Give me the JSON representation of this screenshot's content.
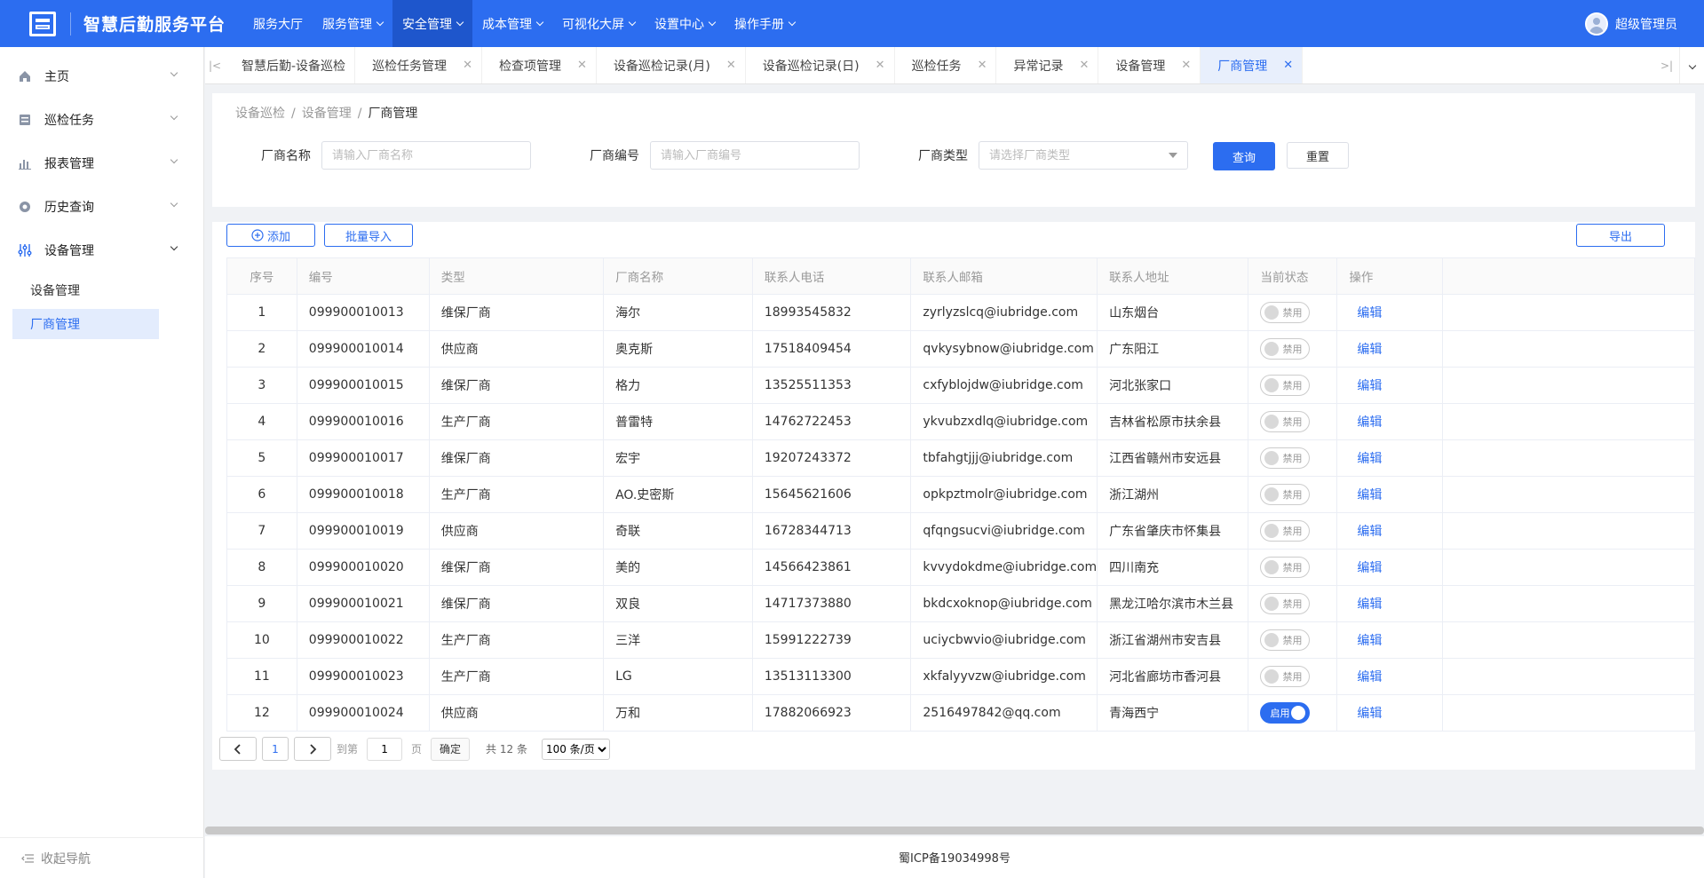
{
  "header": {
    "title": "智慧后勤服务平台",
    "nav": [
      "服务大厅",
      "服务管理",
      "安全管理",
      "成本管理",
      "可视化大屏",
      "设置中心",
      "操作手册"
    ],
    "user": "超级管理员"
  },
  "sidebar": {
    "items": [
      "主页",
      "巡检任务",
      "报表管理",
      "历史查询",
      "设备管理"
    ],
    "sub": [
      "设备管理",
      "厂商管理"
    ],
    "collapse": "收起导航"
  },
  "tabs": [
    "智慧后勤-设备巡检",
    "巡检任务管理",
    "检查项管理",
    "设备巡检记录(月)",
    "设备巡检记录(日)",
    "巡检任务",
    "异常记录",
    "设备管理",
    "厂商管理"
  ],
  "breadcrumb": [
    "设备巡检",
    "设备管理",
    "厂商管理"
  ],
  "filters": {
    "name_label": "厂商名称",
    "name_placeholder": "请输入厂商名称",
    "code_label": "厂商编号",
    "code_placeholder": "请输入厂商编号",
    "type_label": "厂商类型",
    "type_placeholder": "请选择厂商类型",
    "query": "查询",
    "reset": "重置"
  },
  "actions": {
    "add": "添加",
    "import": "批量导入",
    "export": "导出"
  },
  "table": {
    "headers": [
      "序号",
      "编号",
      "类型",
      "厂商名称",
      "联系人电话",
      "联系人邮箱",
      "联系人地址",
      "当前状态",
      "操作"
    ],
    "rows": [
      [
        "1",
        "099900010013",
        "维保厂商",
        "海尔",
        "18993545832",
        "zyrlyzslcq@iubridge.com",
        "山东烟台",
        "禁用",
        "编辑"
      ],
      [
        "2",
        "099900010014",
        "供应商",
        "奥克斯",
        "17518409454",
        "qvkysybnow@iubridge.com",
        "广东阳江",
        "禁用",
        "编辑"
      ],
      [
        "3",
        "099900010015",
        "维保厂商",
        "格力",
        "13525511353",
        "cxfyblojdw@iubridge.com",
        "河北张家口",
        "禁用",
        "编辑"
      ],
      [
        "4",
        "099900010016",
        "生产厂商",
        "普雷特",
        "14762722453",
        "ykvubzxdlq@iubridge.com",
        "吉林省松原市扶余县",
        "禁用",
        "编辑"
      ],
      [
        "5",
        "099900010017",
        "维保厂商",
        "宏宇",
        "19207243372",
        "tbfahgtjjj@iubridge.com",
        "江西省赣州市安远县",
        "禁用",
        "编辑"
      ],
      [
        "6",
        "099900010018",
        "生产厂商",
        "AO.史密斯",
        "15645621606",
        "opkpztmolr@iubridge.com",
        "浙江湖州",
        "禁用",
        "编辑"
      ],
      [
        "7",
        "099900010019",
        "供应商",
        "奇联",
        "16728344713",
        "qfqngsucvi@iubridge.com",
        "广东省肇庆市怀集县",
        "禁用",
        "编辑"
      ],
      [
        "8",
        "099900010020",
        "维保厂商",
        "美的",
        "14566423861",
        "kvvydokdme@iubridge.com",
        "四川南充",
        "禁用",
        "编辑"
      ],
      [
        "9",
        "099900010021",
        "维保厂商",
        "双良",
        "14717373880",
        "bkdcxoknop@iubridge.com",
        "黑龙江哈尔滨市木兰县",
        "禁用",
        "编辑"
      ],
      [
        "10",
        "099900010022",
        "生产厂商",
        "三洋",
        "15991222739",
        "uciycbwvio@iubridge.com",
        "浙江省湖州市安吉县",
        "禁用",
        "编辑"
      ],
      [
        "11",
        "099900010023",
        "生产厂商",
        "LG",
        "13513113300",
        "xkfalyyvzw@iubridge.com",
        "河北省廊坊市香河县",
        "禁用",
        "编辑"
      ],
      [
        "12",
        "099900010024",
        "供应商",
        "万和",
        "17882066923",
        "2516497842@qq.com",
        "青海西宁",
        "启用",
        "编辑"
      ]
    ],
    "status_on": [
      false,
      false,
      false,
      false,
      false,
      false,
      false,
      false,
      false,
      false,
      false,
      true
    ]
  },
  "pager": {
    "current": "1",
    "goto_label": "到第",
    "goto_value": "1",
    "page_unit": "页",
    "confirm": "确定",
    "total": "共 12 条",
    "page_size": "100 条/页"
  },
  "footer": "蜀ICP备19034998号",
  "colors": {
    "primary": "#2c6df0"
  }
}
